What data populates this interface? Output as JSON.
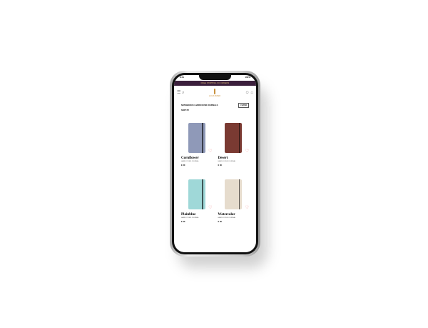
{
  "status": {
    "time": "9:41",
    "battery": "100%"
  },
  "banner": "FREE SHIPPING ON ORDERS",
  "header": {
    "menu_icon": "menu-icon",
    "search_icon": "search-icon",
    "logo": "LUCIA PAPER",
    "account_icon": "account-icon",
    "bag_icon": "bag-icon"
  },
  "breadcrumb": "NOTEBOOKS // HARDCOVER JOURNALS",
  "filter_label": "FILTER",
  "sort_label": "SORT BY",
  "products": [
    {
      "name": "Cornflower",
      "sub": "HARDCOVER JOURNAL",
      "price": "€ 30",
      "color": "#8f99b8"
    },
    {
      "name": "Desert",
      "sub": "HARDCOVER JOURNAL",
      "price": "€ 30",
      "color": "#7a3a32"
    },
    {
      "name": "Plainblue",
      "sub": "HARDCOVER JOURNAL",
      "price": "€ 30",
      "color": "#9fd8d8"
    },
    {
      "name": "Watercolor",
      "sub": "HARDCOVER JOURNAL",
      "price": "€ 30",
      "color": "#e6dccd"
    }
  ]
}
